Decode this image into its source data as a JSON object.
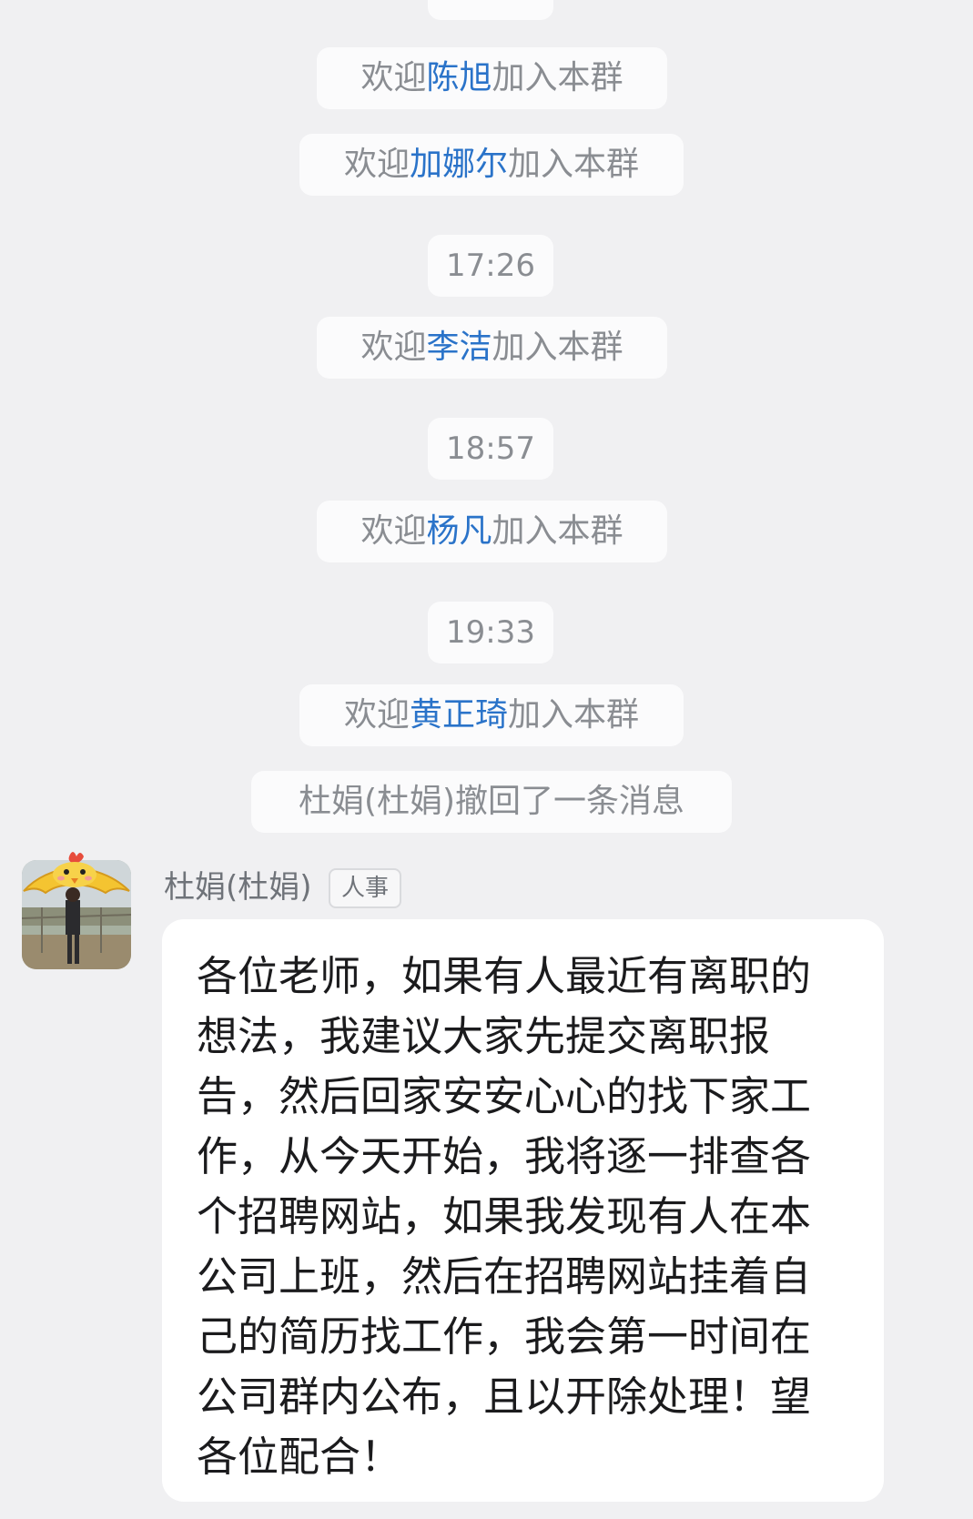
{
  "chat": {
    "system_messages": [
      {
        "prefix": "欢迎",
        "name": "陈旭",
        "suffix": "加入本群"
      },
      {
        "prefix": "欢迎",
        "name": "加娜尔",
        "suffix": "加入本群"
      },
      {
        "time": "17:26"
      },
      {
        "prefix": "欢迎",
        "name": "李洁",
        "suffix": "加入本群"
      },
      {
        "time": "18:57"
      },
      {
        "prefix": "欢迎",
        "name": "杨凡",
        "suffix": "加入本群"
      },
      {
        "time": "19:33"
      },
      {
        "prefix": "欢迎",
        "name": "黄正琦",
        "suffix": "加入本群"
      },
      {
        "text": "杜娟(杜娟)撤回了一条消息"
      }
    ],
    "message": {
      "sender_name": "杜娟(杜娟)",
      "role_badge": "人事",
      "avatar_icon": "chick-hat-avatar-icon",
      "text": "各位老师，如果有人最近有离职的\n想法，我建议大家先提交离职报\n告，然后回家安安心心的找下家工\n作，从今天开始，我将逐一排查各\n个招聘网站，如果我发现有人在本\n公司上班，然后在招聘网站挂着自\n己的简历找工作，我会第一时间在\n公司群内公布，且以开除处理！望\n各位配合！"
    }
  },
  "colors": {
    "background": "#f0f0f2",
    "pill_background": "#fbfbfc",
    "system_text": "#8a8d92",
    "name_highlight": "#2a73c9",
    "bubble": "#ffffff",
    "message_text": "#1b1b1d"
  }
}
